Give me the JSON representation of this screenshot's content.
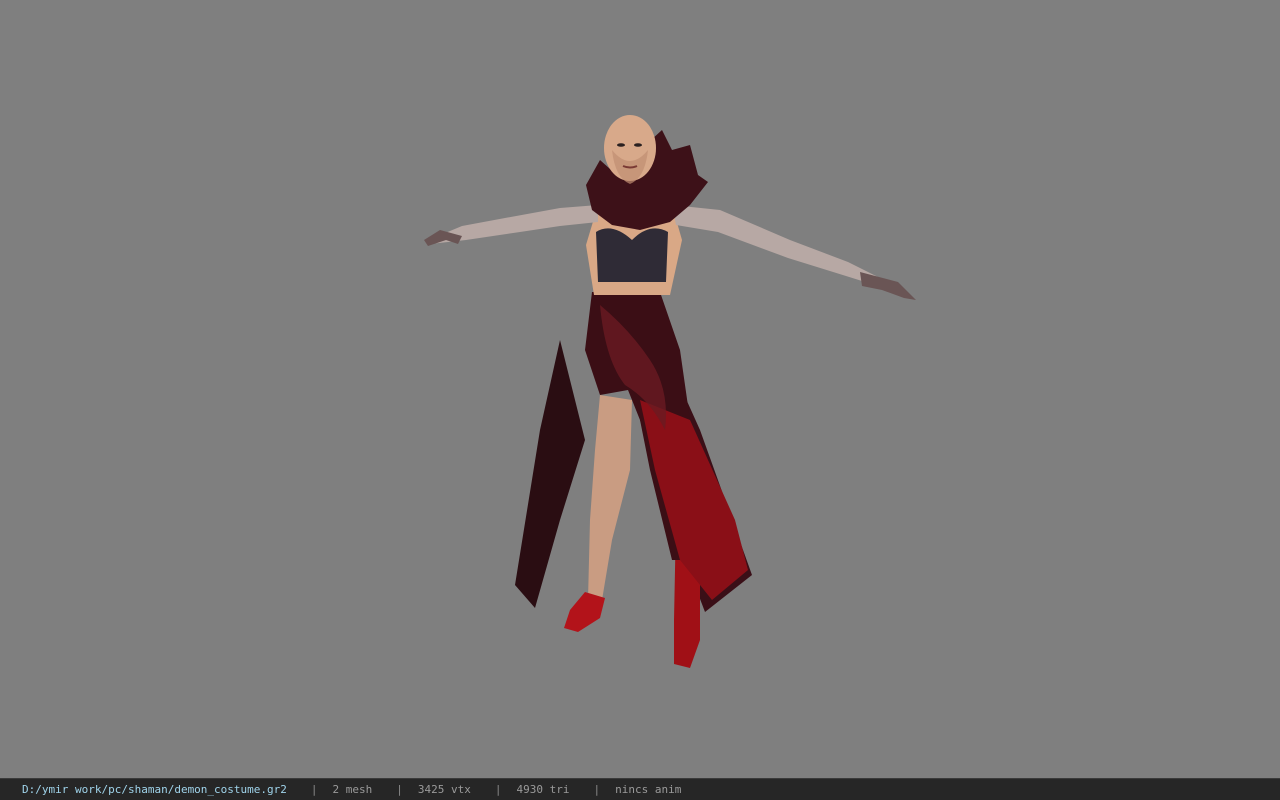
{
  "viewer": {
    "background_color": "#7f7f7f",
    "model_subject": "demon costume character model (shaman)"
  },
  "statusbar": {
    "file_path": "D:/ymir work/pc/shaman/demon_costume.gr2",
    "separator": "|",
    "mesh_count": "2 mesh",
    "vertex_count": "3425 vtx",
    "triangle_count": "4930 tri",
    "animation": "nincs anim"
  }
}
